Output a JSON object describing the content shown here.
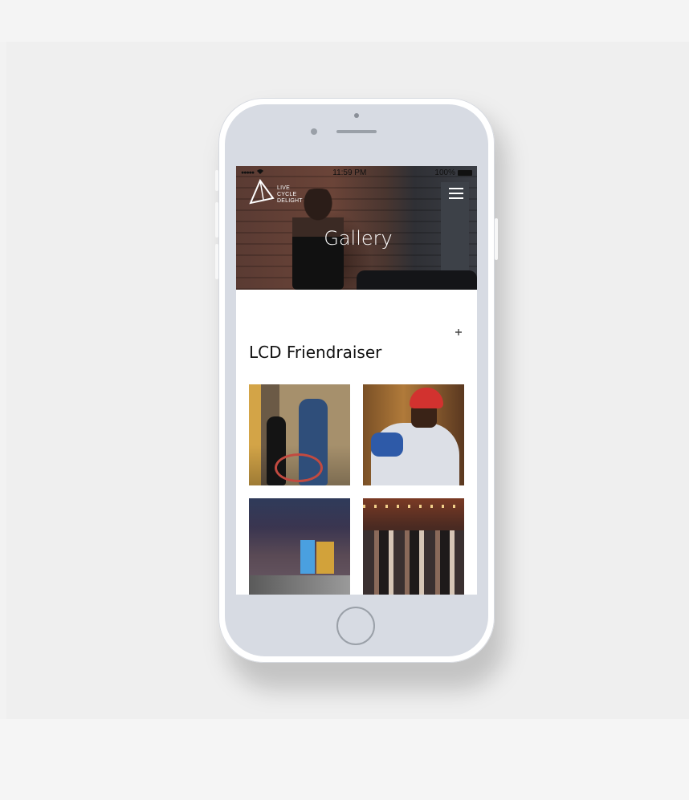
{
  "status_bar": {
    "signal": "●●●●●",
    "time": "11:59 PM",
    "battery_percent": "100%"
  },
  "logo": {
    "lines": [
      "LIVE",
      "CYCLE",
      "DELIGHT"
    ]
  },
  "hero": {
    "title": "Gallery"
  },
  "section": {
    "title": "LCD Friendraiser"
  },
  "gallery": {
    "photos": [
      {
        "subject": "Two people standing with a red bicycle against a brick wall"
      },
      {
        "subject": "Man in red cap riding a stationary bike"
      },
      {
        "subject": "Building exterior at dusk with blue door"
      },
      {
        "subject": "Crowd of people at an indoor event"
      }
    ]
  },
  "colors": {
    "page_background": "#efefef",
    "device_body": "#ffffff",
    "device_bezel": "#d7dbe3",
    "screen_background": "#ffffff",
    "heading_text": "#111111"
  },
  "icons": {
    "menu": "hamburger-menu-icon",
    "plus": "plus-icon",
    "logo_mark": "pyramid-logo-icon"
  }
}
